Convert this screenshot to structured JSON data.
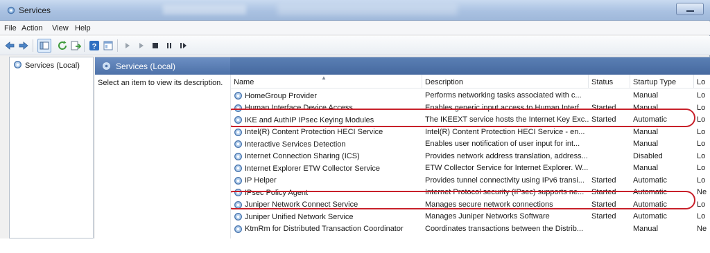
{
  "window": {
    "title": "Services"
  },
  "menu": [
    "File",
    "Action",
    "View",
    "Help"
  ],
  "toolbar_icons": [
    "back-icon",
    "forward-icon",
    "show-console-tree-icon",
    "refresh-icon",
    "export-list-icon",
    "help-icon",
    "properties-icon",
    "start-service-icon",
    "start-service-alt-icon",
    "stop-service-icon",
    "pause-service-icon",
    "restart-service-icon"
  ],
  "tree": {
    "label": "Services (Local)"
  },
  "pane": {
    "header": "Services (Local)",
    "hint": "Select an item to view its description."
  },
  "columns": [
    "Name",
    "Description",
    "Status",
    "Startup Type",
    "Lo"
  ],
  "services": [
    {
      "name": "HomeGroup Provider",
      "description": "Performs networking tasks associated with c...",
      "status": "",
      "startup": "Manual",
      "logon": "Lo"
    },
    {
      "name": "Human Interface Device Access",
      "description": "Enables generic input access to Human Interf...",
      "status": "Started",
      "startup": "Manual",
      "logon": "Lo"
    },
    {
      "name": "IKE and AuthIP IPsec Keying Modules",
      "description": "The IKEEXT service hosts the Internet Key Exc...",
      "status": "Started",
      "startup": "Automatic",
      "logon": "Lo"
    },
    {
      "name": "Intel(R) Content Protection HECI Service",
      "description": "Intel(R) Content Protection HECI Service - en...",
      "status": "",
      "startup": "Manual",
      "logon": "Lo"
    },
    {
      "name": "Interactive Services Detection",
      "description": "Enables user notification of user input for int...",
      "status": "",
      "startup": "Manual",
      "logon": "Lo"
    },
    {
      "name": "Internet Connection Sharing (ICS)",
      "description": "Provides network address translation, address...",
      "status": "",
      "startup": "Disabled",
      "logon": "Lo"
    },
    {
      "name": "Internet Explorer ETW Collector Service",
      "description": "ETW Collector Service for Internet Explorer. W...",
      "status": "",
      "startup": "Manual",
      "logon": "Lo"
    },
    {
      "name": "IP Helper",
      "description": "Provides tunnel connectivity using IPv6 transi...",
      "status": "Started",
      "startup": "Automatic",
      "logon": "Lo"
    },
    {
      "name": "IPsec Policy Agent",
      "description": "Internet Protocol security (IPsec) supports ne...",
      "status": "Started",
      "startup": "Automatic",
      "logon": "Ne"
    },
    {
      "name": "Juniper Network Connect Service",
      "description": "Manages secure network connections",
      "status": "Started",
      "startup": "Automatic",
      "logon": "Lo"
    },
    {
      "name": "Juniper Unified Network Service",
      "description": "Manages Juniper Networks Software",
      "status": "Started",
      "startup": "Automatic",
      "logon": "Lo"
    },
    {
      "name": "KtmRm for Distributed Transaction Coordinator",
      "description": "Coordinates transactions between the Distrib...",
      "status": "",
      "startup": "Manual",
      "logon": "Ne"
    }
  ],
  "highlighted_rows": [
    "IKE and AuthIP IPsec Keying Modules",
    "IPsec Policy Agent"
  ],
  "colors": {
    "header_blue": "#4d71a8",
    "highlight_red": "#c8202a",
    "title_bar": "#aac2e2"
  }
}
